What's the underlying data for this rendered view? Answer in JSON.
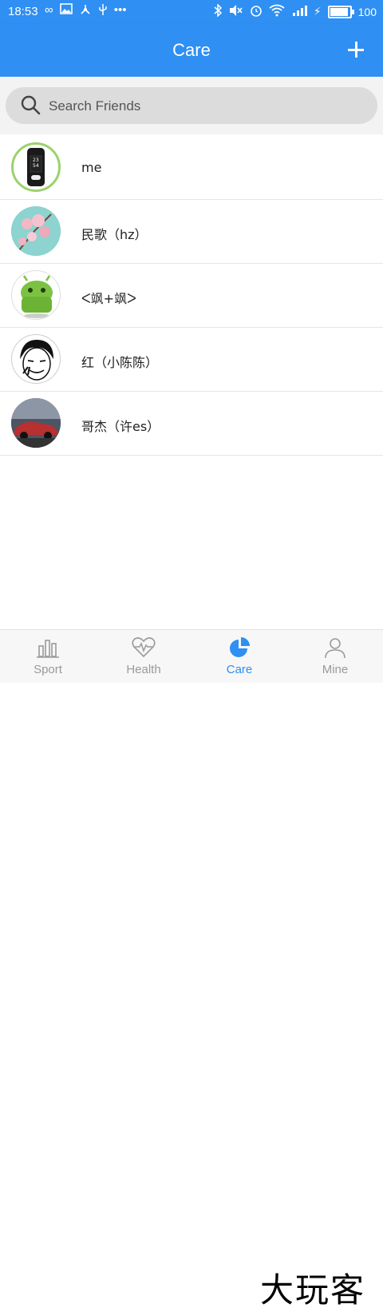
{
  "status_bar": {
    "time": "18:53",
    "battery": "100",
    "battery_level_percent": 100,
    "left_icons": [
      "infinity-icon",
      "image-icon",
      "share-icon",
      "usb-icon",
      "more-dots-icon"
    ],
    "right_icons": [
      "bluetooth-icon",
      "mute-icon",
      "alarm-icon",
      "wifi-icon",
      "signal-4g-icon",
      "charging-icon",
      "battery-icon"
    ]
  },
  "header": {
    "title": "Care",
    "add_icon": "plus-icon"
  },
  "search": {
    "placeholder": "Search Friends",
    "icon": "search-icon"
  },
  "friends": [
    {
      "name": "me",
      "avatar": "fitness-band-avatar"
    },
    {
      "name": "民歌（hz）",
      "avatar": "cherry-blossom-avatar"
    },
    {
      "name": "ᐸ飒+飒ᐳ",
      "avatar": "android-robot-avatar"
    },
    {
      "name": "红（小陈陈）",
      "avatar": "meme-face-avatar"
    },
    {
      "name": "哥杰（许es）",
      "avatar": "sports-car-avatar"
    }
  ],
  "tabs": [
    {
      "label": "Sport",
      "icon": "bar-chart-icon",
      "active": false
    },
    {
      "label": "Health",
      "icon": "heartbeat-icon",
      "active": false
    },
    {
      "label": "Care",
      "icon": "pie-chart-icon",
      "active": true
    },
    {
      "label": "Mine",
      "icon": "person-icon",
      "active": false
    }
  ],
  "watermark": "大玩客",
  "colors": {
    "primary": "#2f8ff2",
    "tab_inactive": "#9a9a9a",
    "row_divider": "#e6e6e6"
  }
}
